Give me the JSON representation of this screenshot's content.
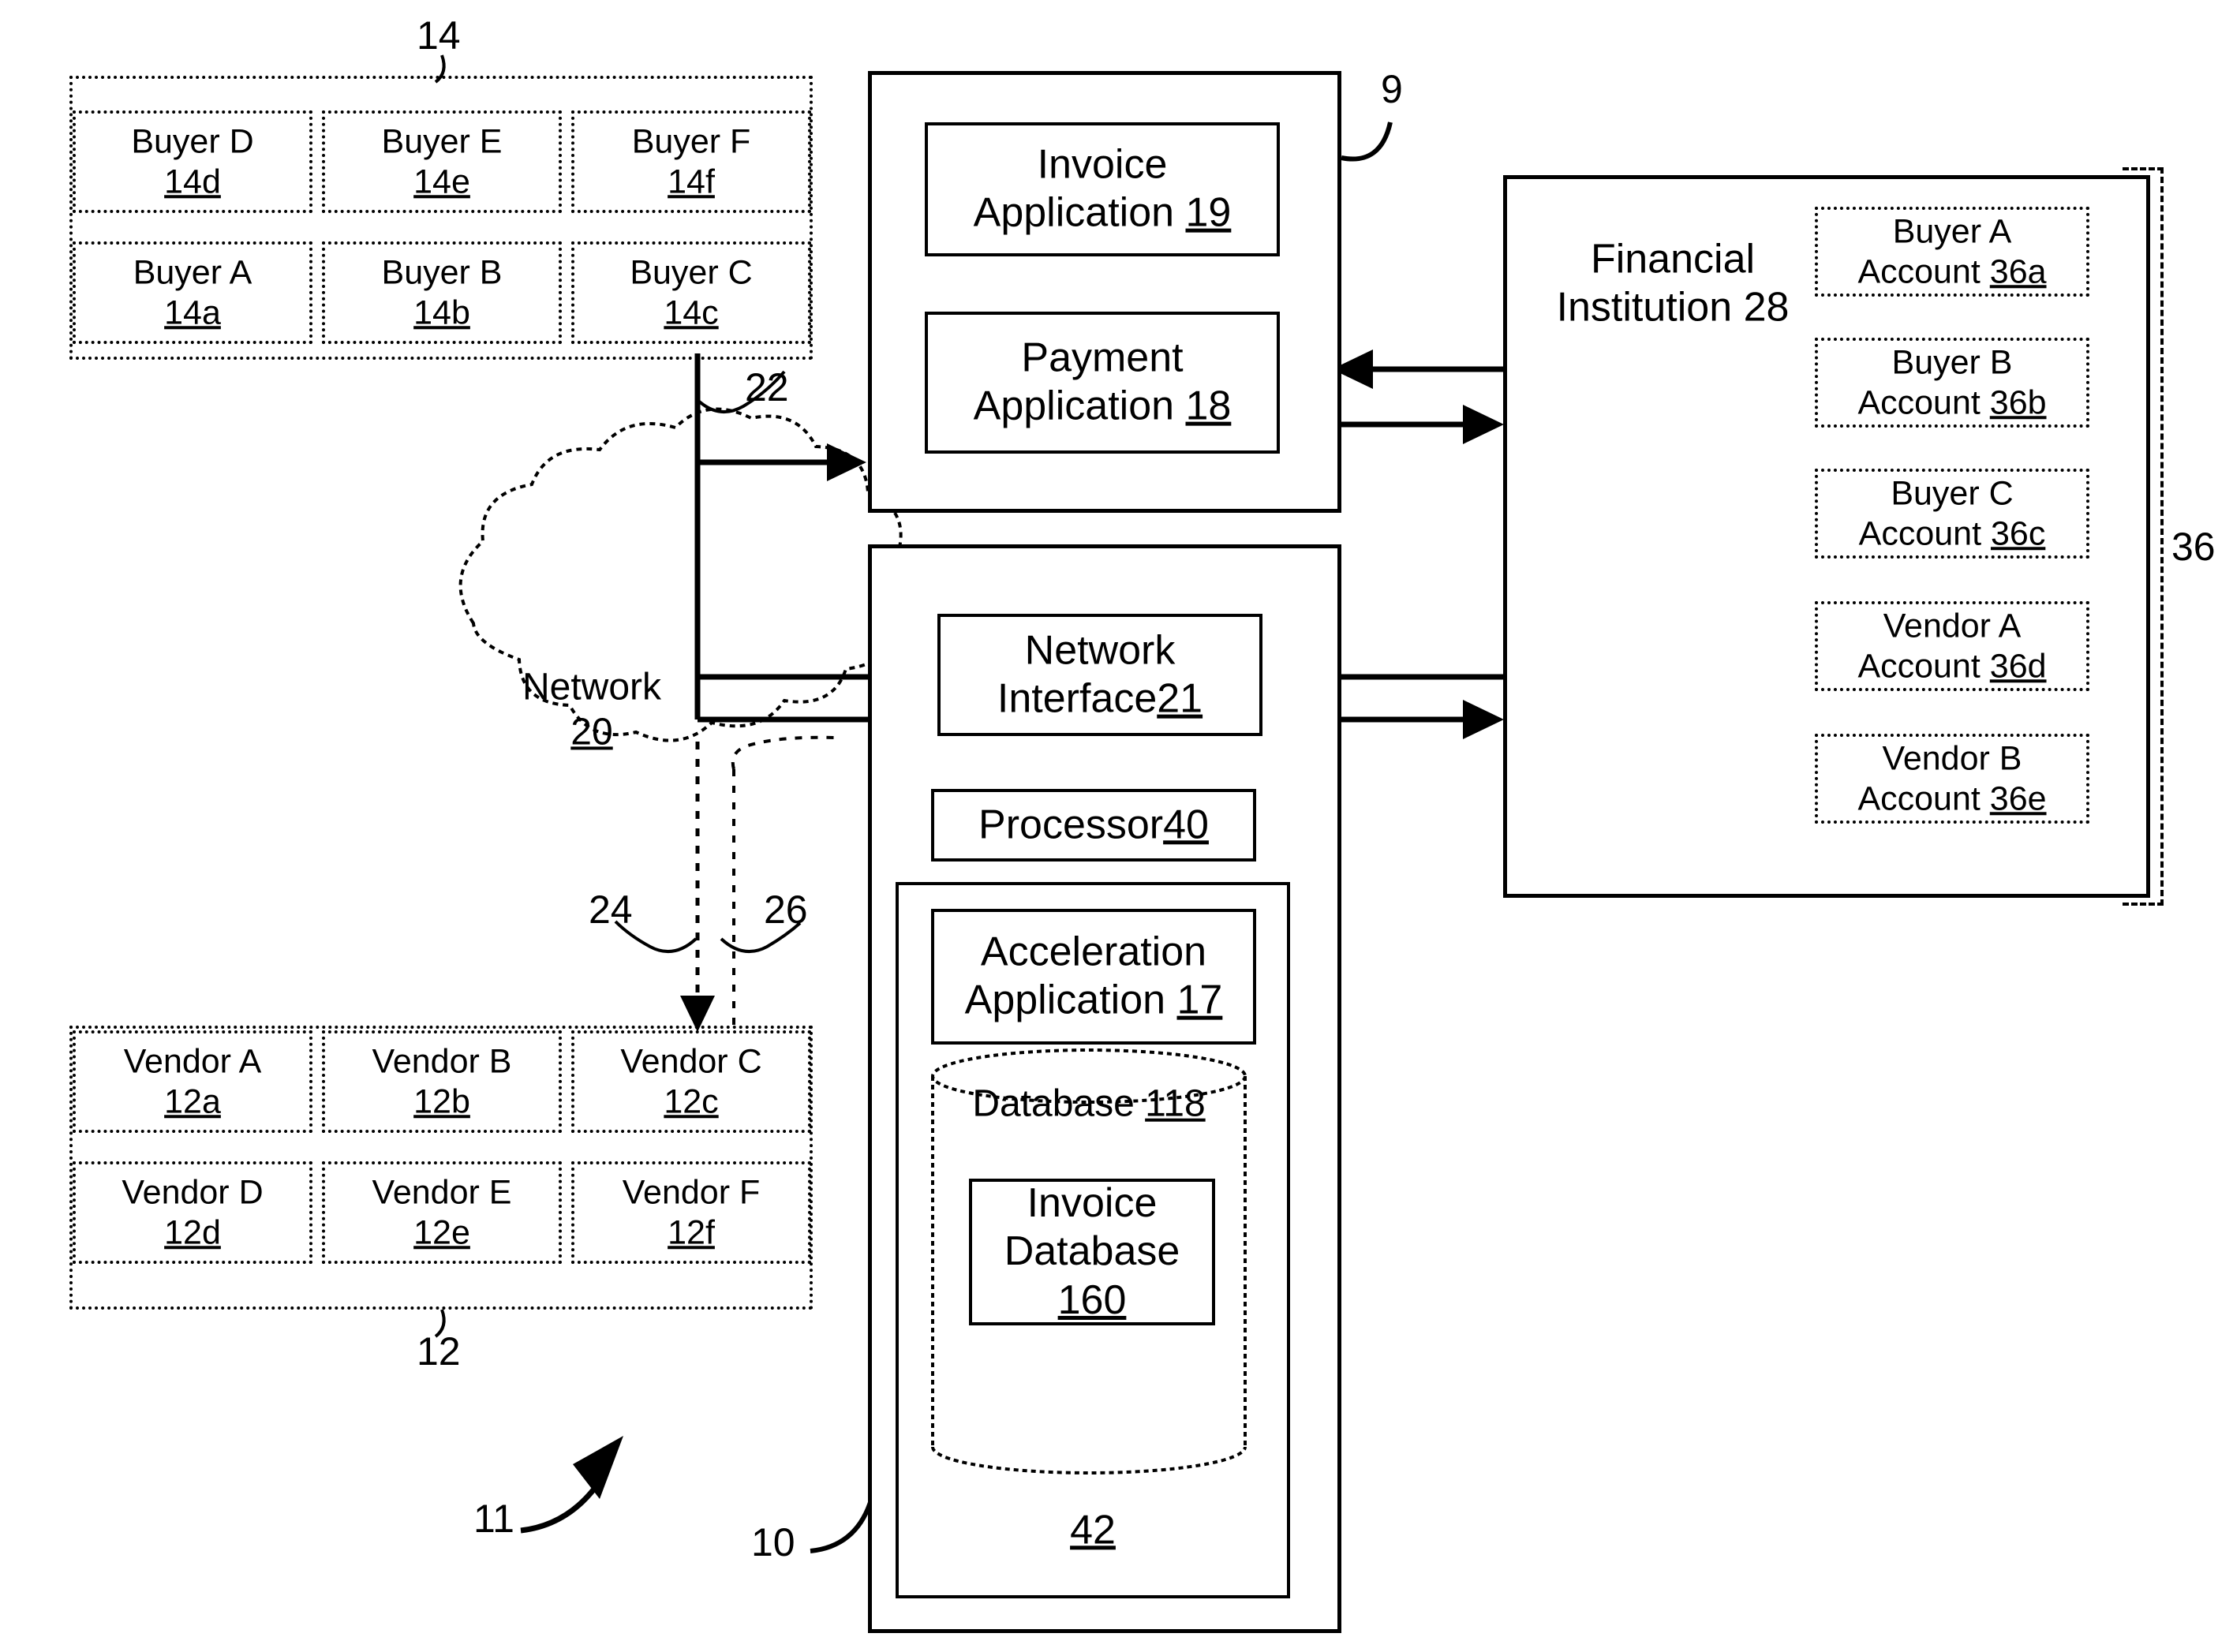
{
  "figure": {
    "title": "Payment acceleration system block diagram",
    "system_ref": "11",
    "server_ref": "10",
    "platform_ref": "9",
    "accounts_group_ref": "36"
  },
  "buyers_group": {
    "label": "14",
    "items": [
      {
        "name": "Buyer D",
        "ref": "14d"
      },
      {
        "name": "Buyer E",
        "ref": "14e"
      },
      {
        "name": "Buyer F",
        "ref": "14f"
      },
      {
        "name": "Buyer A",
        "ref": "14a"
      },
      {
        "name": "Buyer B",
        "ref": "14b"
      },
      {
        "name": "Buyer C",
        "ref": "14c"
      }
    ]
  },
  "vendors_group": {
    "label": "12",
    "items": [
      {
        "name": "Vendor A",
        "ref": "12a"
      },
      {
        "name": "Vendor B",
        "ref": "12b"
      },
      {
        "name": "Vendor C",
        "ref": "12c"
      },
      {
        "name": "Vendor D",
        "ref": "12d"
      },
      {
        "name": "Vendor E",
        "ref": "12e"
      },
      {
        "name": "Vendor F",
        "ref": "12f"
      }
    ]
  },
  "network": {
    "name": "Network",
    "ref": "20",
    "link_buyer_label": "22",
    "link_vendor_label": "24",
    "link_vendor_alt_label": "26"
  },
  "platform": {
    "ref": "9",
    "invoice_application": {
      "name": "Invoice Application",
      "ref": "19"
    },
    "payment_application": {
      "name": "Payment Application",
      "ref": "18"
    }
  },
  "server": {
    "ref": "10",
    "network_interface": {
      "name": "Network Interface",
      "ref": "21"
    },
    "processor": {
      "name": "Processor",
      "ref": "40"
    },
    "memory_ref": "42",
    "acceleration_application": {
      "name": "Acceleration Application",
      "ref": "17"
    },
    "database": {
      "name": "Database",
      "ref": "118"
    },
    "invoice_database": {
      "name": "Invoice Database",
      "ref": "160"
    }
  },
  "financial_institution": {
    "name": "Financial Institution",
    "ref": "28",
    "accounts_group_ref": "36",
    "accounts": [
      {
        "owner": "Buyer A",
        "line2": "Account",
        "ref": "36a"
      },
      {
        "owner": "Buyer B",
        "line2": "Account",
        "ref": "36b"
      },
      {
        "owner": "Buyer C",
        "line2": "Account",
        "ref": "36c"
      },
      {
        "owner": "Vendor A",
        "line2": "Account",
        "ref": "36d"
      },
      {
        "owner": "Vendor B",
        "line2": "Account",
        "ref": "36e"
      }
    ]
  }
}
